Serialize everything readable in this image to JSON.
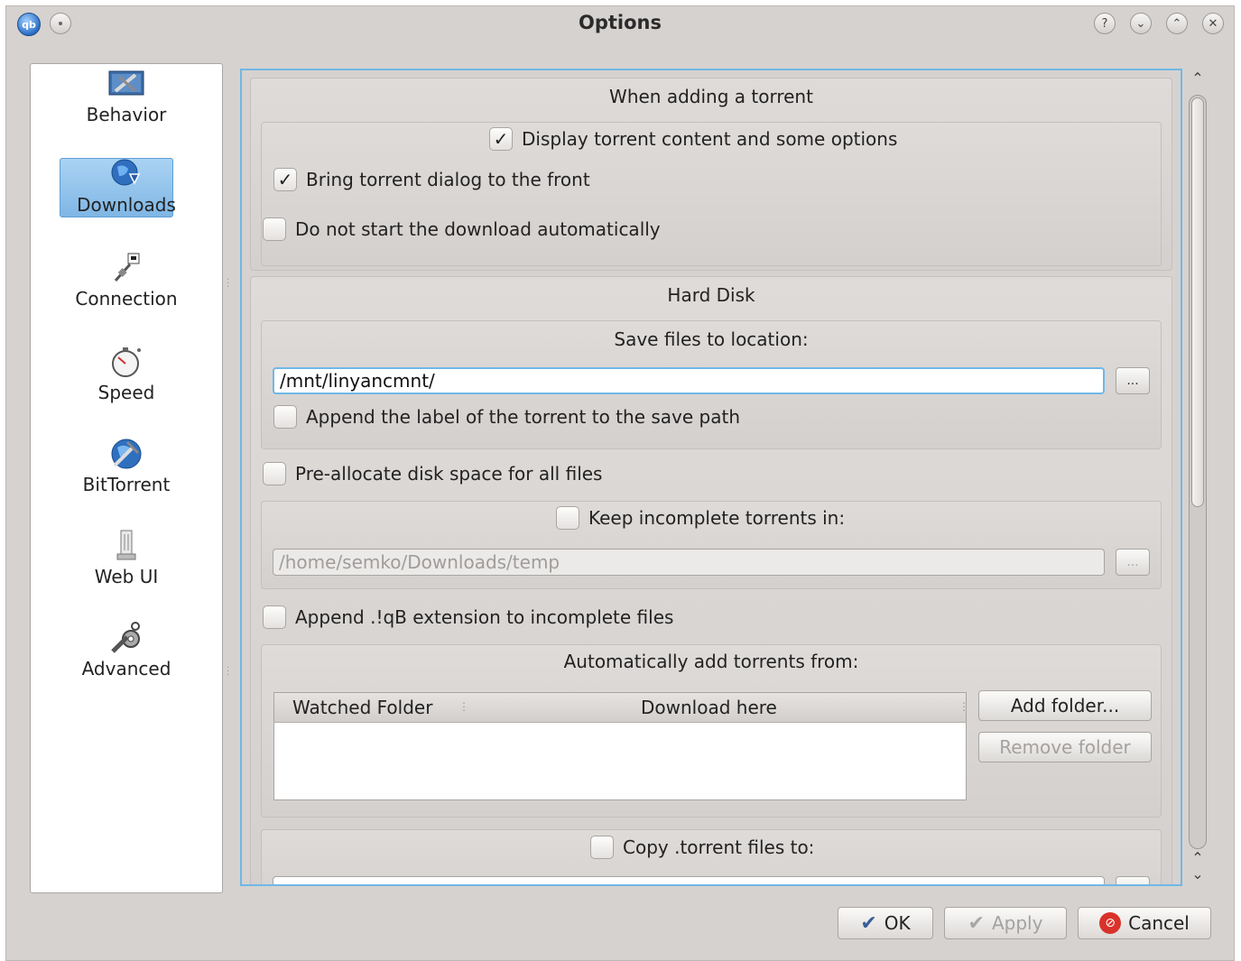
{
  "window": {
    "title": "Options"
  },
  "titlebar": {
    "app_icon_text": "qb",
    "buttons": [
      "?",
      "⌄",
      "⌃",
      "✕"
    ]
  },
  "sidebar": {
    "items": [
      {
        "label": "Behavior",
        "icon": "behavior-icon"
      },
      {
        "label": "Downloads",
        "icon": "downloads-icon",
        "selected": true
      },
      {
        "label": "Connection",
        "icon": "connection-icon"
      },
      {
        "label": "Speed",
        "icon": "speed-icon"
      },
      {
        "label": "BitTorrent",
        "icon": "bittorrent-icon"
      },
      {
        "label": "Web UI",
        "icon": "webui-icon"
      },
      {
        "label": "Advanced",
        "icon": "advanced-icon"
      }
    ]
  },
  "downloads": {
    "adding": {
      "title": "When adding a torrent",
      "display_content": {
        "label": "Display torrent content and some options",
        "checked": true
      },
      "bring_front": {
        "label": "Bring torrent dialog to the front",
        "checked": true
      },
      "no_autostart": {
        "label": "Do not start the download automatically",
        "checked": false
      }
    },
    "hard_disk": {
      "title": "Hard Disk",
      "save_location_title": "Save files to location:",
      "save_path": "/mnt/linyancmnt/",
      "browse_label": "...",
      "append_label": {
        "label": "Append the label of the torrent to the save path",
        "checked": false
      },
      "preallocate": {
        "label": "Pre-allocate disk space for all files",
        "checked": false
      },
      "keep_incomplete": {
        "label": "Keep incomplete torrents in:",
        "checked": false
      },
      "incomplete_path": "/home/semko/Downloads/temp",
      "append_qb": {
        "label": "Append .!qB extension to incomplete files",
        "checked": false
      }
    },
    "auto_add": {
      "title": "Automatically add torrents from:",
      "col_watched": "Watched Folder",
      "col_download": "Download here",
      "add_folder": "Add folder...",
      "remove_folder": "Remove folder"
    },
    "copy_torrent": {
      "label": "Copy .torrent files to:",
      "checked": false
    }
  },
  "footer": {
    "ok": "OK",
    "apply": "Apply",
    "cancel": "Cancel"
  },
  "colors": {
    "focus_accent": "#6fb8e6",
    "selection": "#8fc2ec",
    "cancel_red": "#d8322a"
  }
}
